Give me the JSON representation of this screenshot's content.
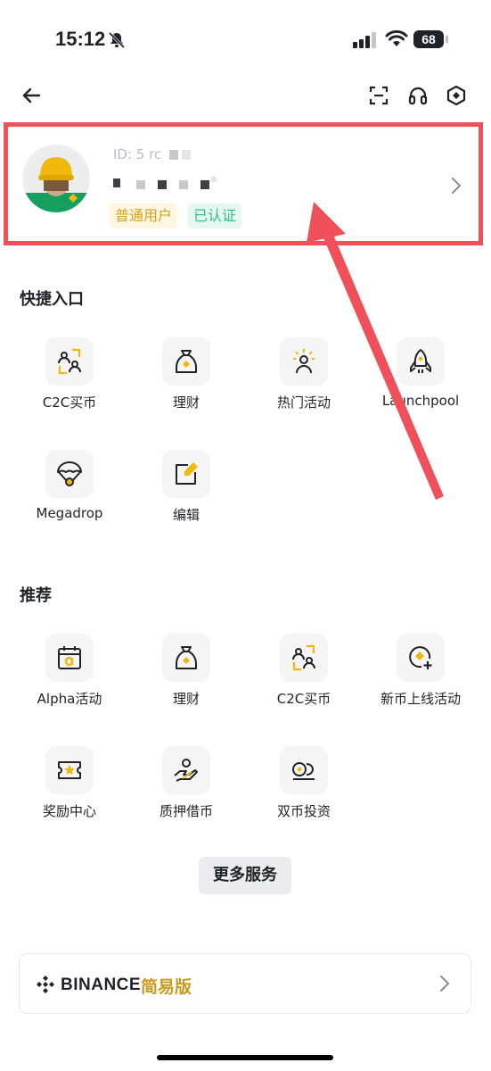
{
  "status_bar": {
    "time": "15:12",
    "battery": "68"
  },
  "top_bar": {
    "icons": [
      "back-arrow-icon",
      "scan-icon",
      "headset-icon",
      "settings-icon"
    ]
  },
  "profile": {
    "id_prefix": "ID: 5 rc",
    "badge_user": "普通用户",
    "badge_verified": "已认证"
  },
  "shortcuts": {
    "title": "快捷入口",
    "items": [
      {
        "label": "C2C买币",
        "icon": "c2c-users-icon"
      },
      {
        "label": "理财",
        "icon": "money-bag-icon"
      },
      {
        "label": "热门活动",
        "icon": "hot-event-person-icon"
      },
      {
        "label": "Launchpool",
        "icon": "rocket-icon"
      },
      {
        "label": "Megadrop",
        "icon": "parachute-icon"
      },
      {
        "label": "编辑",
        "icon": "edit-icon"
      }
    ]
  },
  "recommend": {
    "title": "推荐",
    "items": [
      {
        "label": "Alpha活动",
        "icon": "alpha-calendar-icon"
      },
      {
        "label": "理财",
        "icon": "money-bag-icon"
      },
      {
        "label": "C2C买币",
        "icon": "c2c-users-icon"
      },
      {
        "label": "新币上线活动",
        "icon": "new-coin-add-icon"
      },
      {
        "label": "奖励中心",
        "icon": "reward-ticket-icon"
      },
      {
        "label": "质押借币",
        "icon": "hand-coin-icon"
      },
      {
        "label": "双币投资",
        "icon": "dual-coin-icon"
      }
    ]
  },
  "more_services": "更多服务",
  "lite": {
    "brand": "BINANCE",
    "label": "简易版"
  },
  "colors": {
    "accent_yellow": "#f0b90b",
    "annotation_red": "#f0505a",
    "verified_green": "#2fbf8a"
  }
}
